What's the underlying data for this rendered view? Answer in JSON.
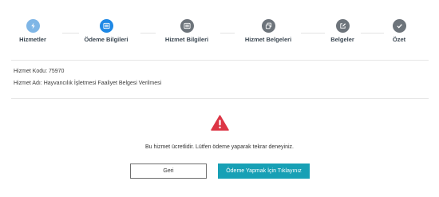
{
  "stepper": {
    "steps": [
      {
        "label": "Hizmetler",
        "icon": "bolt-icon",
        "state": "done"
      },
      {
        "label": "Ödeme Bilgileri",
        "icon": "list-icon",
        "state": "active"
      },
      {
        "label": "Hizmet Bilgileri",
        "icon": "list-icon",
        "state": "pending"
      },
      {
        "label": "Hizmet Belgeleri",
        "icon": "copy-icon",
        "state": "pending"
      },
      {
        "label": "Belgeler",
        "icon": "edit-icon",
        "state": "pending"
      },
      {
        "label": "Özet",
        "icon": "check-icon",
        "state": "pending"
      }
    ]
  },
  "service": {
    "code": "Hizmet Kodu: 75970",
    "name": "Hizmet Adı: Hayvancılık İşletmesi Faaliyet Belgesi Verilmesi"
  },
  "alert": {
    "icon": "warning-icon",
    "message": "Bu hizmet ücretlidir. Lütfen ödeme yaparak tekrar deneyiniz."
  },
  "buttons": {
    "back_label": "Geri",
    "pay_label": "Ödeme Yapmak İçin Tıklayınız"
  },
  "colors": {
    "done": "#7fb6e6",
    "active": "#1e88e5",
    "pending": "#6d747b",
    "warning": "#dc3545",
    "primary_button": "#17a0b5"
  }
}
